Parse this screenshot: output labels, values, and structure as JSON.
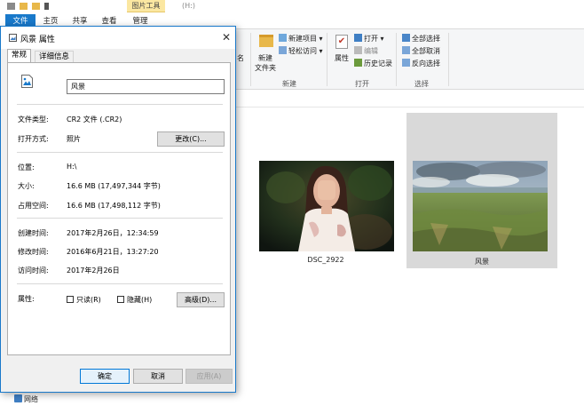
{
  "explorer": {
    "tool_group_label": "图片工具",
    "drive_title": "(H:)",
    "tabs": [
      "文件",
      "主页",
      "共享",
      "查看",
      "管理"
    ],
    "ribbon": {
      "cut_label": "名",
      "new_folder_label_1": "新建",
      "new_folder_label_2": "文件夹",
      "new_item": "新建项目",
      "easy_access": "轻松访问",
      "group_new": "新建",
      "properties": "属性",
      "open": "打开",
      "edit": "编辑",
      "history": "历史记录",
      "group_open": "打开",
      "select_all": "全部选择",
      "select_none": "全部取消",
      "invert_selection": "反向选择",
      "group_select": "选择"
    },
    "files": [
      {
        "name": "DSC_2922"
      },
      {
        "name": "风景"
      }
    ],
    "nav_network": "网络"
  },
  "dialog": {
    "title": "风景 属性",
    "tabs": [
      "常规",
      "详细信息"
    ],
    "file_name": "风景",
    "rows": {
      "file_type_label": "文件类型:",
      "file_type_value": "CR2 文件 (.CR2)",
      "open_with_label": "打开方式:",
      "open_with_value": "照片",
      "change_button": "更改(C)...",
      "location_label": "位置:",
      "location_value": "H:\\",
      "size_label": "大小:",
      "size_value": "16.6 MB (17,497,344 字节)",
      "disk_size_label": "占用空间:",
      "disk_size_value": "16.6 MB (17,498,112 字节)",
      "created_label": "创建时间:",
      "created_value": "2017年2月26日，12:34:59",
      "modified_label": "修改时间:",
      "modified_value": "2016年6月21日，13:27:20",
      "accessed_label": "访问时间:",
      "accessed_value": "2017年2月26日",
      "attributes_label": "属性:",
      "readonly_label": "只读(R)",
      "hidden_label": "隐藏(H)",
      "advanced_button": "高级(D)..."
    },
    "buttons": {
      "ok": "确定",
      "cancel": "取消",
      "apply": "应用(A)"
    },
    "close_glyph": "✕"
  },
  "colors": {
    "accent": "#1979ca",
    "dialog_bg": "#f0f0f0",
    "tool_highlight": "#fbe7a1",
    "selected_tile": "#d9d9d9"
  },
  "icons": {
    "folder": "folder-icon",
    "properties": "properties-check-icon",
    "picture_file": "picture-file-icon",
    "network": "network-icon"
  }
}
